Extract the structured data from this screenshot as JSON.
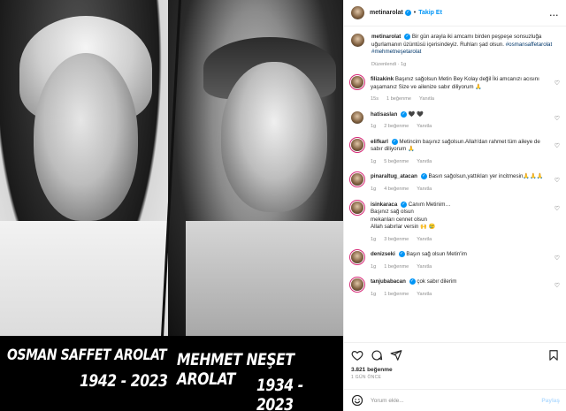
{
  "photo": {
    "left_name": "OSMAN SAFFET AROLAT",
    "left_years": "1942 - 2023",
    "right_name": "MEHMET NEŞET AROLAT",
    "right_years": "1934 - 2023"
  },
  "header": {
    "username": "metinarolat",
    "separator": "•",
    "follow_label": "Takip Et",
    "more": "..."
  },
  "caption": {
    "username": "metinarolat",
    "text": "Bir gün arayla iki amcamı birden peşpeşe sonsuzluğa uğurlamanın üzüntüsü içerisindeyiz. Ruhları şad olsun.",
    "hashtags": "#osmansaffetarolat #mehmetneşetarolat",
    "meta": "Düzenlendi · 1g"
  },
  "comments": [
    {
      "username": "filizakink",
      "text": "Başınız sağolsun Metin Bey Kolay değil İki amcanızı acısını yaşamanız Size ve ailenize sabır diliyorum 🙏",
      "time": "15s",
      "likes": "1 beğenme",
      "reply": "Yanıtla"
    },
    {
      "username": "hatisaslan",
      "text": "🖤 🖤",
      "time": "1g",
      "likes": "2 beğenme",
      "reply": "Yanıtla"
    },
    {
      "username": "elifkarl",
      "text": "Metincim başınız sağolsun.Allah'dan rahmet tüm aileye de sabır diliyorum 🙏",
      "time": "1g",
      "likes": "5 beğenme",
      "reply": "Yanıtla"
    },
    {
      "username": "pinaraltug_atacan",
      "text": "Basın sağolsun,yattıkları yer incitmesin🙏🙏🙏",
      "time": "1g",
      "likes": "4 beğenme",
      "reply": "Yanıtla"
    },
    {
      "username": "isinkaraca",
      "text": "Canım Metinim…",
      "line2": "Başınız sağ olsun",
      "line3": "mekanları cennet olsun",
      "line4": "Allah sabırlar versin 🙌 😢",
      "time": "1g",
      "likes": "3 beğenme",
      "reply": "Yanıtla"
    },
    {
      "username": "denizseki",
      "text": "Başın sağ olsun Metin'im",
      "time": "1g",
      "likes": "1 beğenme",
      "reply": "Yanıtla"
    },
    {
      "username": "tanjubabacan",
      "text": "çok sabır dilerim",
      "time": "1g",
      "likes": "1 beğenme",
      "reply": "Yanıtla"
    }
  ],
  "stats": {
    "likes": "3.821 beğenme",
    "date": "1 GÜN ÖNCE"
  },
  "comment_box": {
    "placeholder": "Yorum ekle...",
    "post_label": "Paylaş"
  }
}
